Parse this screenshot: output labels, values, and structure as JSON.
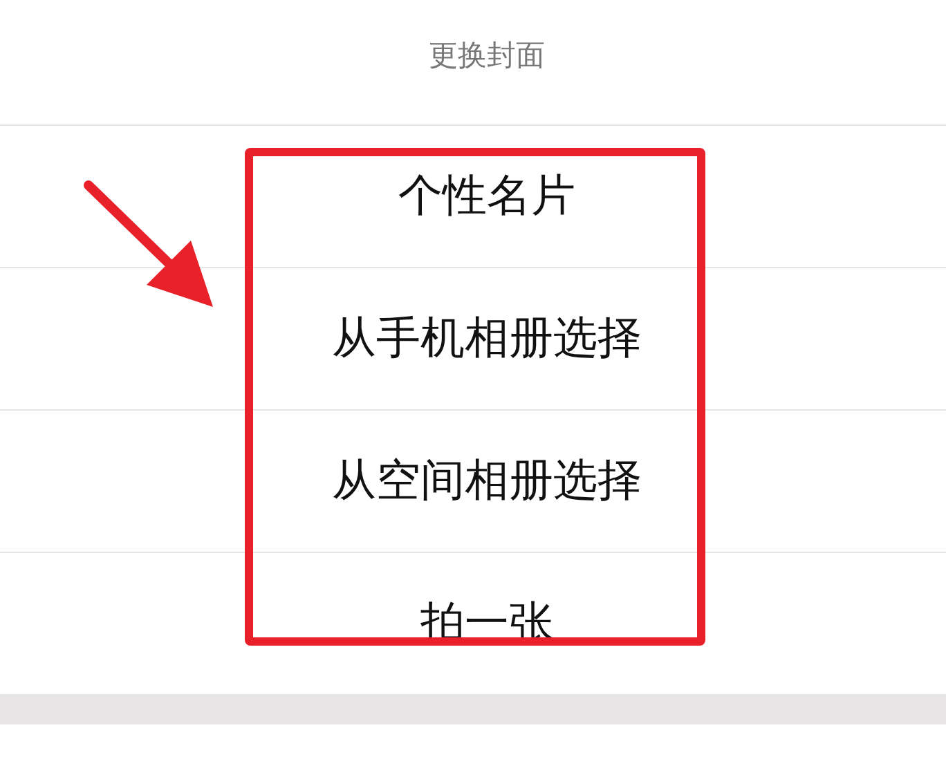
{
  "sheet": {
    "title": "更换封面",
    "options": [
      {
        "label": "个性名片"
      },
      {
        "label": "从手机相册选择"
      },
      {
        "label": "从空间相册选择"
      },
      {
        "label": "拍一张"
      }
    ]
  }
}
